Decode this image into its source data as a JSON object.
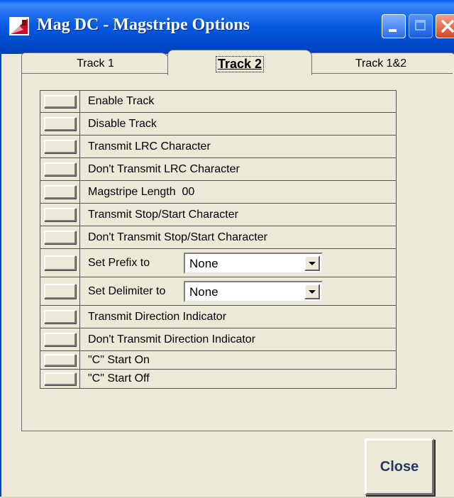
{
  "window": {
    "title": "Mag DC - Magstripe Options",
    "icon": "mag-dc-app-icon",
    "controls": [
      "minimize-icon",
      "maximize-icon",
      "close-icon"
    ]
  },
  "tabs": [
    {
      "label": "Track 1",
      "selected": false
    },
    {
      "label": "Track 2",
      "selected": true
    },
    {
      "label": "Track 1&2",
      "selected": false
    }
  ],
  "options": {
    "enable_track": "Enable Track",
    "disable_track": "Disable Track",
    "transmit_lrc": "Transmit LRC Character",
    "dont_transmit_lrc": "Don't Transmit LRC Character",
    "magstripe_length": "Magstripe Length  00",
    "transmit_stop_start": "Transmit Stop/Start Character",
    "dont_transmit_stop_start": "Don't Transmit Stop/Start Character",
    "set_prefix": "Set Prefix to",
    "prefix_value": "None",
    "set_delimiter": "Set Delimiter to",
    "delimiter_value": "None",
    "transmit_direction": "Transmit Direction Indicator",
    "dont_transmit_direction": "Don't Transmit Direction Indicator",
    "c_start_on": "\"C\" Start On",
    "c_start_off": "\"C\" Start Off"
  },
  "footer": {
    "close_label": "Close"
  },
  "colors": {
    "titlebar": "#0459e0",
    "dialog_bg": "#ece9d8",
    "close_text": "#1f3a64"
  }
}
